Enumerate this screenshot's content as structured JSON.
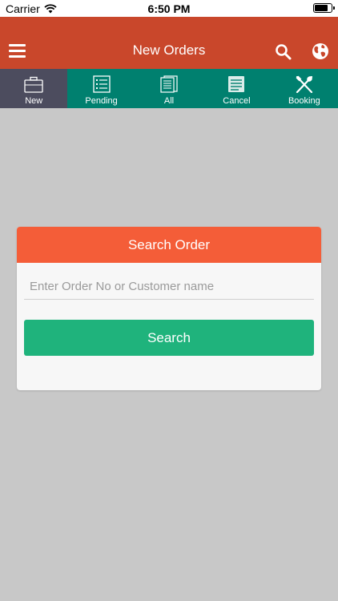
{
  "status_bar": {
    "carrier": "Carrier",
    "time": "6:50 PM",
    "battery_level": 0.8
  },
  "header": {
    "title": "New Orders",
    "menu_icon": "hamburger-menu-icon",
    "search_icon": "search-icon",
    "globe_icon": "globe-icon",
    "background": "#c9472b"
  },
  "tabs": [
    {
      "label": "New",
      "icon": "briefcase-icon",
      "active": true
    },
    {
      "label": "Pending",
      "icon": "checklist-icon",
      "active": false
    },
    {
      "label": "All",
      "icon": "documents-icon",
      "active": false
    },
    {
      "label": "Cancel",
      "icon": "document-lines-icon",
      "active": false
    },
    {
      "label": "Booking",
      "icon": "fork-spoon-icon",
      "active": false
    }
  ],
  "search_card": {
    "title": "Search Order",
    "input_placeholder": "Enter Order No or Customer name",
    "input_value": "",
    "button_label": "Search"
  },
  "colors": {
    "tab_bar": "#00806f",
    "tab_active": "#4c4c5e",
    "card_header": "#f45d38",
    "search_button": "#1fb37c",
    "backdrop": "#c8c8c8"
  }
}
